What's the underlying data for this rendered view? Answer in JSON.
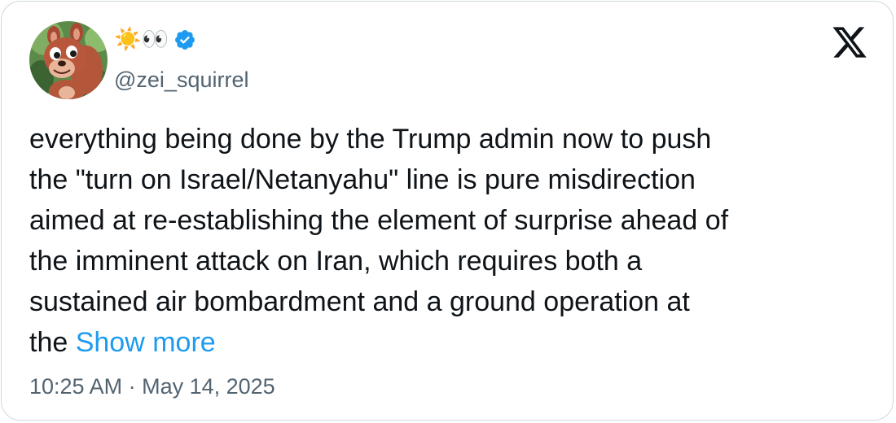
{
  "author": {
    "display_name": "☀️👀",
    "handle": "@zei_squirrel",
    "verified": true,
    "avatar": "cartoon-squirrel-avatar"
  },
  "tweet": {
    "lines": [
      "everything being done by the Trump admin now to push",
      "the \"turn on Israel/Netanyahu\" line is pure misdirection",
      "aimed at re-establishing the element of surprise ahead of",
      "the imminent attack on Iran, which requires both a",
      "sustained air bombardment and a ground operation at",
      "the"
    ],
    "show_more_label": "Show more"
  },
  "timestamp": "10:25 AM · May 14, 2025",
  "icons": {
    "logo": "x-logo-icon",
    "verified": "verified-badge-icon"
  },
  "colors": {
    "link": "#1d9bf0",
    "text": "#0f1419",
    "secondary": "#536471",
    "verified": "#1d9bf0",
    "border": "#cfd9de"
  }
}
